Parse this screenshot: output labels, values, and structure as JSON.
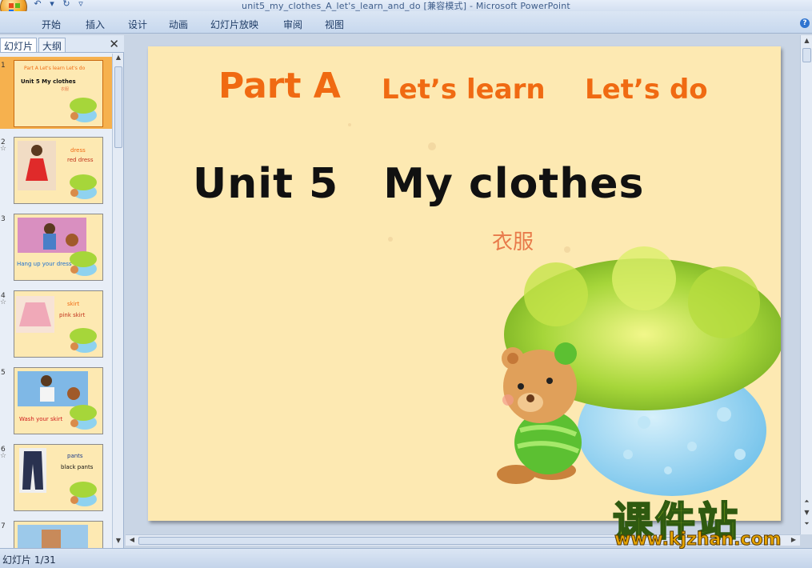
{
  "window": {
    "title": "unit5_my_clothes_A_let's_learn_and_do [兼容模式] - Microsoft PowerPoint"
  },
  "ribbon": {
    "tabs": [
      "开始",
      "插入",
      "设计",
      "动画",
      "幻灯片放映",
      "审阅",
      "视图"
    ]
  },
  "pane": {
    "tabs": [
      "幻灯片",
      "大纲"
    ],
    "thumbnails": [
      {
        "num": "1",
        "lines": [
          "Part A  Let's learn  Let's do",
          "Unit 5  My clothes",
          "衣服"
        ]
      },
      {
        "num": "2",
        "lines": [
          "dress",
          "red dress"
        ]
      },
      {
        "num": "3",
        "lines": [
          "Hang up your dress"
        ]
      },
      {
        "num": "4",
        "lines": [
          "skirt",
          "pink skirt"
        ]
      },
      {
        "num": "5",
        "lines": [
          "Wash your skirt"
        ]
      },
      {
        "num": "6",
        "lines": [
          "pants",
          "black pants"
        ]
      },
      {
        "num": "7",
        "lines": []
      }
    ]
  },
  "slide": {
    "part": "Part A",
    "learn": "Let’s learn",
    "do": "Let’s do",
    "unit": "Unit 5",
    "title": "My clothes",
    "chinese": "衣服"
  },
  "status": {
    "text": "幻灯片 1/31"
  },
  "watermark": {
    "cn": "课件站",
    "url": "www.kjzhan.com"
  },
  "colors": {
    "slide_bg": "#fde9b2",
    "heading_orange": "#f06a12",
    "title_black": "#111111",
    "chinese_text": "#e87a4a",
    "selection": "#f6b14e"
  }
}
